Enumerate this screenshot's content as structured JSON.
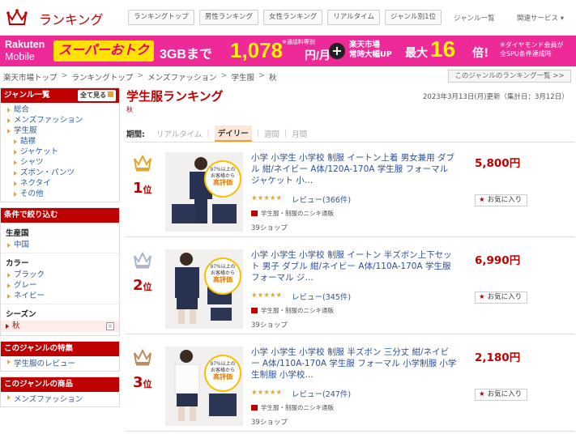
{
  "header": {
    "brand": "ランキング",
    "nav": [
      "ランキングトップ",
      "男性ランキング",
      "女性ランキング",
      "リアルタイム",
      "ジャンル別1位"
    ],
    "genre_list": "ジャンル一覧",
    "related": "関連サービス ▾"
  },
  "banner": {
    "rakuten_line1": "Rakuten",
    "rakuten_line2": "Mobile",
    "super": "スーパーおトク",
    "gb": "3GBまで",
    "price": "1,078",
    "per_month": "円/月",
    "price_note": "※通話料等別",
    "ichiba_line1": "楽天市場",
    "ichiba_line2": "常時大幅UP",
    "max": "最大",
    "times": "16",
    "bai": "倍!",
    "diamond_line1": "※ダイヤモンド会員が",
    "diamond_line2": "全SPU条件達成時"
  },
  "breadcrumb": [
    "楽天市場トップ",
    "ランキングトップ",
    "メンズファッション",
    "学生服",
    "秋"
  ],
  "breadcrumb_sep": ">",
  "genre_ranking_list": "このジャンルのランキング一覧 >>",
  "sidebar": {
    "genre_header": "ジャンル一覧",
    "see_all": "全て見る",
    "genres_top": [
      "総合",
      "メンズファッション"
    ],
    "genre_current": "学生服",
    "genres_sub": [
      "詰襟",
      "ジャケット",
      "シャツ",
      "ズボン・パンツ",
      "ネクタイ",
      "その他"
    ],
    "filter_header": "条件で絞り込む",
    "country_label": "生産国",
    "country": "中国",
    "color_label": "カラー",
    "colors": [
      "ブラック",
      "グレー",
      "ネイビー"
    ],
    "season_label": "シーズン",
    "season": "秋",
    "feature_header": "このジャンルの特集",
    "feature": "学生服のレビュー",
    "products_header": "このジャンルの商品",
    "products": "メンズファッション"
  },
  "main": {
    "title": "学生服ランキング",
    "subtag": "秋",
    "updated": "2023年3月13日(月)更新（集計日：3月12日）",
    "period_label": "期間:",
    "periods": [
      "リアルタイム",
      "デイリー",
      "週間",
      "月間"
    ],
    "period_active": "デイリー",
    "items": [
      {
        "rank": "1",
        "rank_unit": "位",
        "title": "小学 小学生 小学校 制服 イートン上着 男女兼用 ダブル 紺/ネイビー A体/120A-170A 学生服 フォーマル ジャケット 小…",
        "price": "5,800円",
        "stars": "★★★★★",
        "reviews": "レビュー(366件)",
        "shop_label": "学生服・制服のニシキ通販",
        "shop": "39ショップ",
        "fav": "お気に入り",
        "badge1": "97%以上の",
        "badge2": "お客様から",
        "badge3": "高評価"
      },
      {
        "rank": "2",
        "rank_unit": "位",
        "title": "小学 小学生 小学校 制服 イートン 半ズボン上下セット 男子 ダブル 紺/ネイビー A体/110A-170A 学生服 フォーマル ジ…",
        "price": "6,990円",
        "stars": "★★★★★",
        "reviews": "レビュー(345件)",
        "shop_label": "学生服・制服のニシキ通販",
        "shop": "39ショップ",
        "fav": "お気に入り",
        "badge1": "97%以上の",
        "badge2": "お客様から",
        "badge3": "高評価"
      },
      {
        "rank": "3",
        "rank_unit": "位",
        "title": "小学 小学生 小学校 制服 半ズボン 三分丈 紺/ネイビー A体/110A-170A 学生服 フォーマル 小学制服 小学生制服 小学校…",
        "price": "2,180円",
        "stars": "★★★★★",
        "reviews": "レビュー(247件)",
        "shop_label": "学生服・制服のニシキ通販",
        "shop": "39ショップ",
        "fav": "お気に入り",
        "badge1": "97%以上の",
        "badge2": "お客様から",
        "badge3": "高評価"
      }
    ]
  },
  "colors": {
    "accent": "#bf0000",
    "banner": "#ee2a99",
    "gold": "#e9a52a",
    "silver": "#a8b6c8",
    "bronze": "#c08a5c"
  }
}
